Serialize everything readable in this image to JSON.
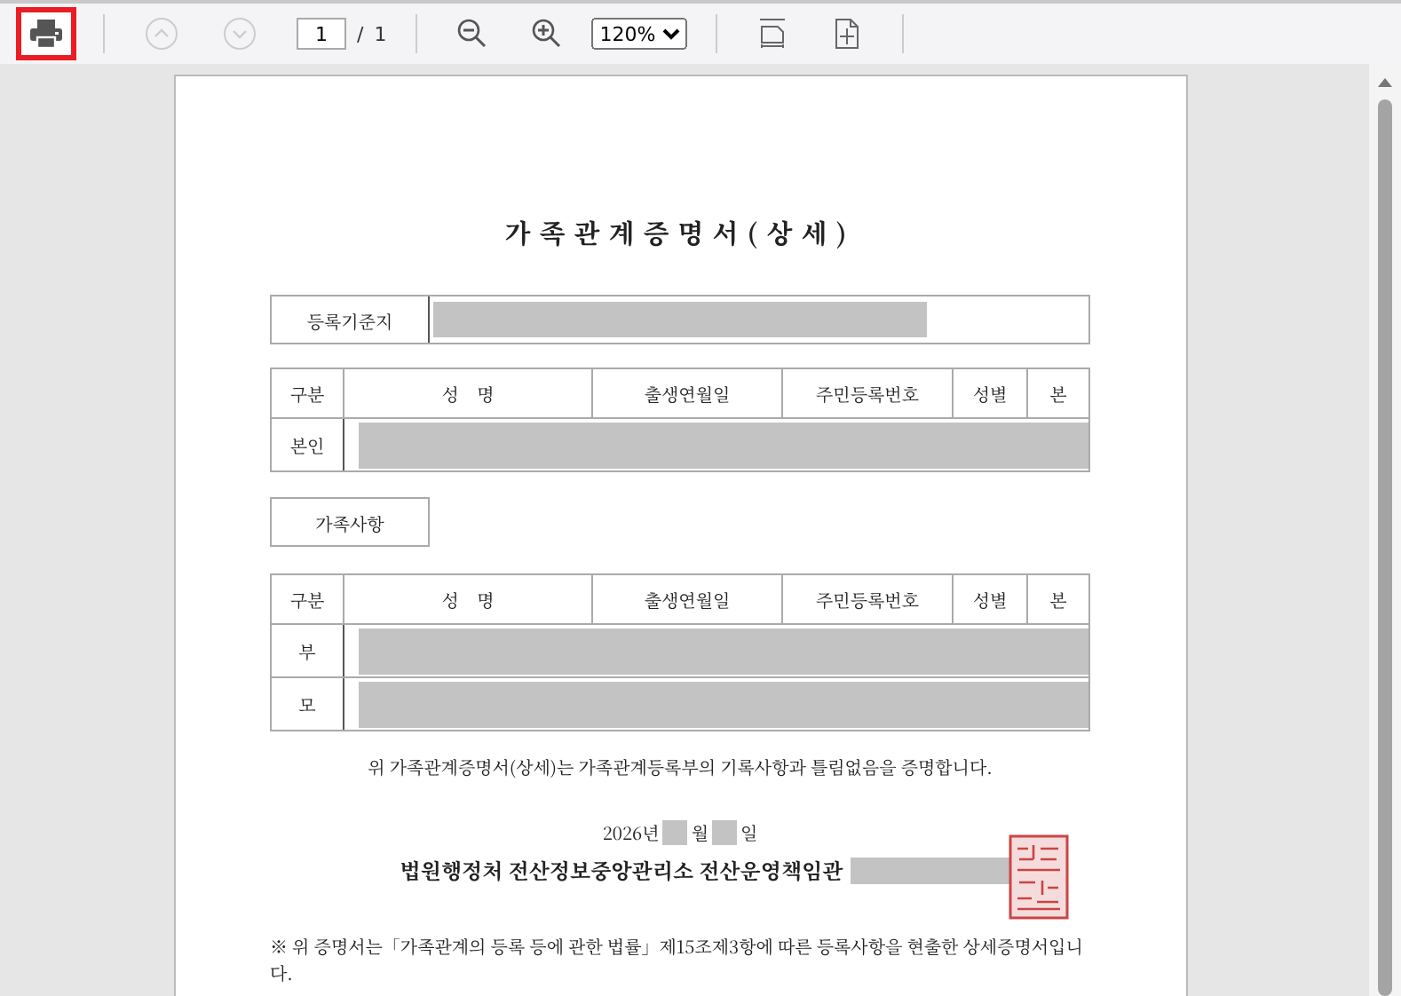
{
  "toolbar": {
    "print_highlighted": true,
    "page_number": "1",
    "page_separator": "/",
    "page_count": "1",
    "zoom": "120%"
  },
  "document": {
    "title": "가족관계증명서(상세)",
    "registration": {
      "label": "등록기준지",
      "redacted": true
    },
    "self_columns": [
      "구분",
      "성    명",
      "출생연월일",
      "주민등록번호",
      "성별",
      "본"
    ],
    "self_rows": [
      {
        "label": "본인",
        "redacted": true
      }
    ],
    "family_heading": "가족사항",
    "family_columns": [
      "구분",
      "성    명",
      "출생연월일",
      "주민등록번호",
      "성별",
      "본"
    ],
    "family_rows": [
      {
        "label": "부",
        "redacted": true
      },
      {
        "label": "모",
        "redacted": true
      }
    ],
    "statement": "위 가족관계증명서(상세)는 가족관계등록부의 기록사항과 틀림없음을 증명합니다.",
    "date": {
      "year": "2026년",
      "month_redacted": true,
      "month_unit": "월",
      "day_redacted": true,
      "day_unit": "일"
    },
    "issuer": "법원행정처 전산정보중앙관리소 전산운영책임관",
    "issuer_name_redacted": true,
    "seal": true,
    "note": "※ 위 증명서는「가족관계의 등록 등에 관한 법률」제15조제3항에 따른 등록사항을 현출한 상세증명서입니다."
  }
}
